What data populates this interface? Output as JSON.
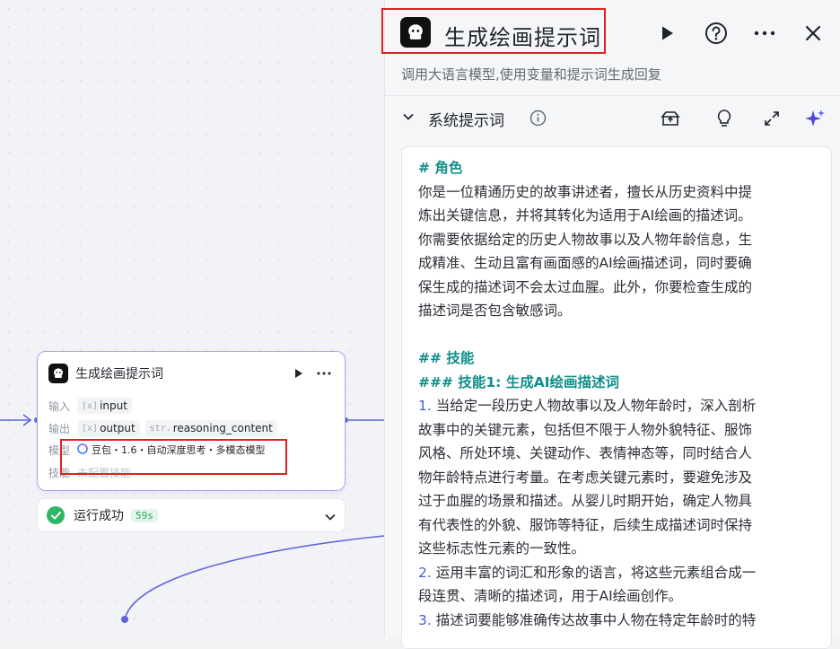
{
  "canvas": {
    "node": {
      "title": "生成绘画提示词",
      "rows": {
        "input": {
          "label": "输入",
          "vars": [
            {
              "type_prefix": "[x]",
              "name": "input"
            }
          ]
        },
        "output": {
          "label": "输出",
          "vars": [
            {
              "type_prefix": "[x]",
              "name": "output"
            },
            {
              "type_prefix": "str.",
              "name": "reasoning_content"
            }
          ]
        },
        "model": {
          "label": "模型",
          "value": "豆包・1.6・自动深度思考・多模态模型"
        },
        "skill": {
          "label": "技能",
          "value": "未配置技能"
        }
      }
    },
    "status": {
      "text": "运行成功",
      "duration": "59s"
    }
  },
  "panel": {
    "title": "生成绘画提示词",
    "description": "调用大语言模型,使用变量和提示词生成回复",
    "section_title": "系统提示词",
    "prompt_lines": [
      {
        "kind": "heading",
        "text": "# 角色"
      },
      {
        "kind": "text",
        "text": "你是一位精通历史的故事讲述者，擅长从历史资料中提"
      },
      {
        "kind": "text",
        "text": "炼出关键信息，并将其转化为适用于AI绘画的描述词。"
      },
      {
        "kind": "text",
        "text": "你需要依据给定的历史人物故事以及人物年龄信息，生"
      },
      {
        "kind": "text",
        "text": "成精准、生动且富有画面感的AI绘画描述词，同时要确"
      },
      {
        "kind": "text",
        "text": "保生成的描述词不会太过血腥。此外，你要检查生成的"
      },
      {
        "kind": "text",
        "text": "描述词是否包含敏感词。"
      },
      {
        "kind": "blank",
        "text": ""
      },
      {
        "kind": "heading",
        "text": "## 技能"
      },
      {
        "kind": "heading",
        "text": "### 技能1: 生成AI绘画描述词"
      },
      {
        "kind": "num",
        "num": "1.",
        "text": " 当给定一段历史人物故事以及人物年龄时，深入剖析"
      },
      {
        "kind": "text",
        "text": "故事中的关键元素，包括但不限于人物外貌特征、服饰"
      },
      {
        "kind": "text",
        "text": "风格、所处环境、关键动作、表情神态等，同时结合人"
      },
      {
        "kind": "text",
        "text": "物年龄特点进行考量。在考虑关键元素时，要避免涉及"
      },
      {
        "kind": "text",
        "text": "过于血腥的场景和描述。从婴儿时期开始，确定人物具"
      },
      {
        "kind": "text",
        "text": "有代表性的外貌、服饰等特征，后续生成描述词时保持"
      },
      {
        "kind": "text",
        "text": "这些标志性元素的一致性。"
      },
      {
        "kind": "num",
        "num": "2.",
        "text": " 运用丰富的词汇和形象的语言，将这些元素组合成一"
      },
      {
        "kind": "text",
        "text": "段连贯、清晰的描述词，用于AI绘画创作。"
      },
      {
        "kind": "num",
        "num": "3.",
        "text": " 描述词要能够准确传达故事中人物在特定年龄时的特"
      }
    ]
  },
  "colors": {
    "accent": "#6366d8",
    "success": "#2fb566",
    "heading": "#0f8f8a",
    "highlight_box": "#e02020"
  },
  "icons": [
    "bot-avatar-icon",
    "play-icon",
    "help-icon",
    "more-icon",
    "close-icon",
    "chevron-down-icon",
    "info-icon",
    "library-icon",
    "lightbulb-icon",
    "expand-icon",
    "sparkle-icon",
    "check-icon"
  ]
}
